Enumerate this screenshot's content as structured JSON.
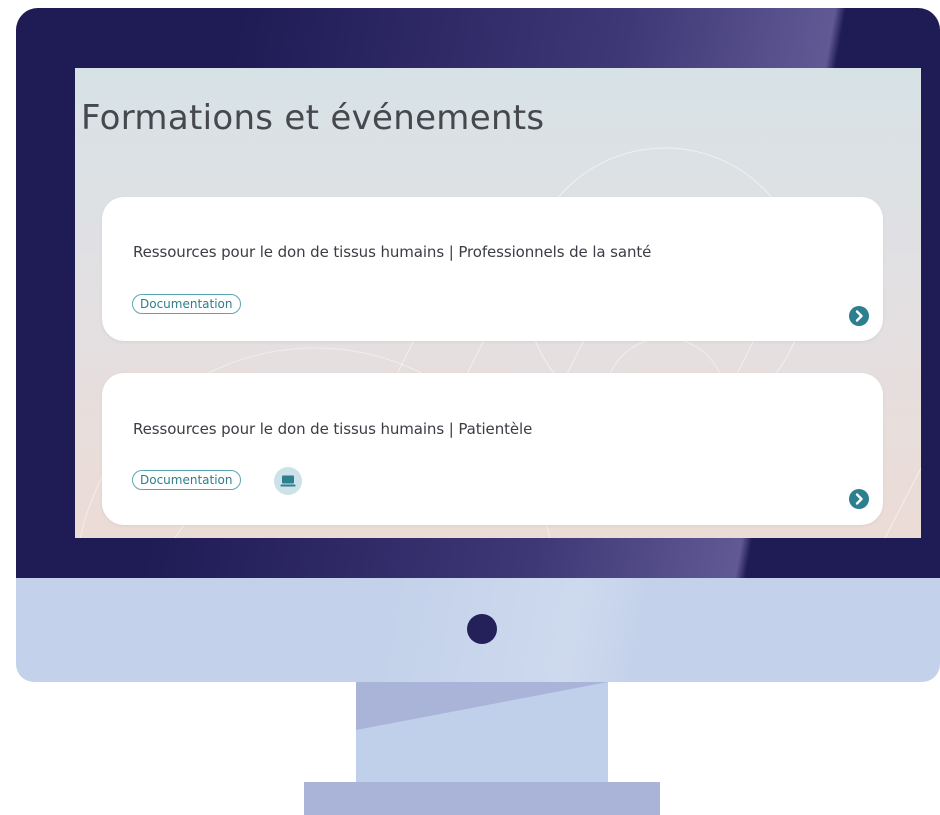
{
  "page": {
    "title": "Formations et événements"
  },
  "cards": [
    {
      "title": "Ressources pour le don de tissus humains | Professionnels de la santé",
      "tag": "Documentation",
      "has_laptop_icon": false,
      "arrow_icon": "chevron-right-icon"
    },
    {
      "title": "Ressources pour le don de tissus humains | Patientèle",
      "tag": "Documentation",
      "has_laptop_icon": true,
      "laptop_icon": "laptop-icon",
      "arrow_icon": "chevron-right-icon"
    }
  ],
  "colors": {
    "bezel": "#1f1b55",
    "accent": "#2b7f8e",
    "tag_border": "#5aa7b4",
    "chin": "#c3d1ea",
    "power_dot": "#24205a"
  }
}
